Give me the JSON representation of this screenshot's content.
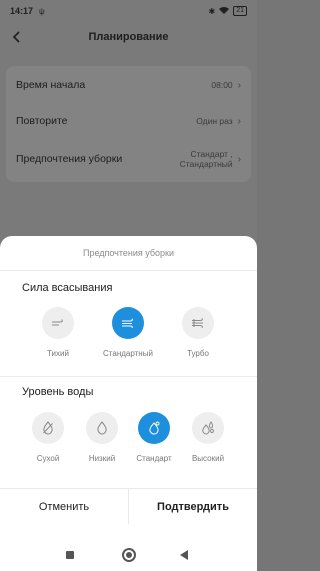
{
  "status_bar": {
    "time": "14:17",
    "misc": "ψ",
    "battery": "21"
  },
  "header": {
    "title": "Планирование"
  },
  "settings": {
    "rows": [
      {
        "label": "Время начала",
        "value": "08:00"
      },
      {
        "label": "Повторите",
        "value": "Один раз"
      },
      {
        "label": "Предпочтения уборки",
        "value": "Стандарт ,\nСтандартный"
      }
    ]
  },
  "sheet": {
    "title": "Предпочтения уборки",
    "suction": {
      "title": "Сила всасывания",
      "options": [
        {
          "label": "Тихий",
          "icon": "wind-low-icon",
          "selected": false
        },
        {
          "label": "Стандартный",
          "icon": "wind-standard-icon",
          "selected": true
        },
        {
          "label": "Турбо",
          "icon": "wind-turbo-icon",
          "selected": false
        }
      ]
    },
    "water": {
      "title": "Уровень воды",
      "options": [
        {
          "label": "Сухой",
          "icon": "no-drop-icon",
          "selected": false
        },
        {
          "label": "Низкий",
          "icon": "drop-low-icon",
          "selected": false
        },
        {
          "label": "Стандарт",
          "icon": "drop-standard-icon",
          "selected": true
        },
        {
          "label": "Высокий",
          "icon": "drop-high-icon",
          "selected": false
        }
      ]
    },
    "cancel_label": "Отменить",
    "confirm_label": "Подтвердить"
  },
  "colors": {
    "accent": "#1e8fdc",
    "overlay": "#7a7a7a"
  }
}
